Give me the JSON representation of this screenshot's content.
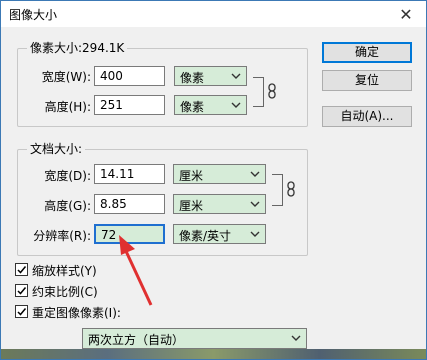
{
  "dialog": {
    "title": "图像大小"
  },
  "pixel_dimensions": {
    "legend": "像素大小:294.1K",
    "width": {
      "label": "宽度(W):",
      "value": "400",
      "unit": "像素"
    },
    "height": {
      "label": "高度(H):",
      "value": "251",
      "unit": "像素"
    }
  },
  "document_size": {
    "legend": "文档大小:",
    "width": {
      "label": "宽度(D):",
      "value": "14.11",
      "unit": "厘米"
    },
    "height": {
      "label": "高度(G):",
      "value": "8.85",
      "unit": "厘米"
    },
    "resolution": {
      "label": "分辨率(R):",
      "value": "72",
      "unit": "像素/英寸"
    }
  },
  "options": {
    "scale_styles": {
      "label": "缩放样式(Y)",
      "checked": true
    },
    "constrain": {
      "label": "约束比例(C)",
      "checked": true
    },
    "resample": {
      "label": "重定图像像素(I):",
      "checked": true
    },
    "resample_method": "两次立方（自动）"
  },
  "buttons": {
    "ok": "确定",
    "reset": "复位",
    "auto": "自动(A)..."
  },
  "colors": {
    "accent": "#0078d7",
    "field_green": "#d6ecd8",
    "arrow_red": "#e03030"
  }
}
